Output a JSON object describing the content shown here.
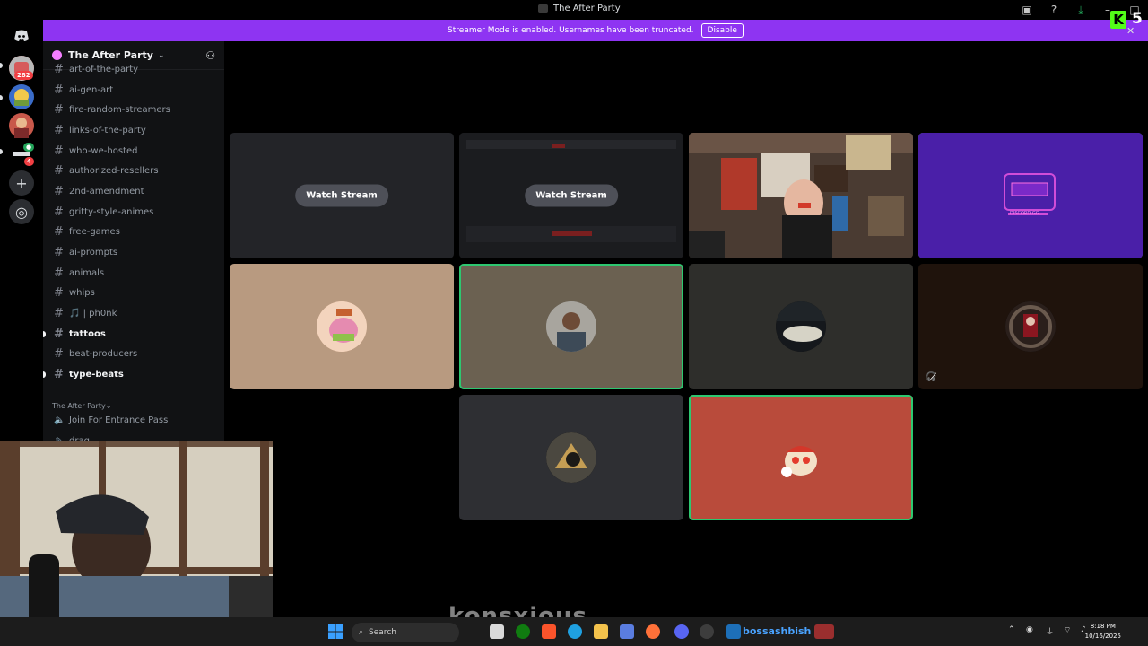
{
  "window": {
    "title": "The After Party"
  },
  "banner": {
    "text": "Streamer Mode is enabled. Usernames have been truncated.",
    "button": "Disable"
  },
  "rail": {
    "badges": [
      "282",
      "4"
    ]
  },
  "sidebar": {
    "server_name": "The After Party",
    "channels": [
      {
        "name": "art-of-the-party",
        "unread": false
      },
      {
        "name": "ai-gen-art",
        "unread": false
      },
      {
        "name": "fire-random-streamers",
        "unread": false
      },
      {
        "name": "links-of-the-party",
        "unread": false
      },
      {
        "name": "who-we-hosted",
        "unread": false
      },
      {
        "name": "authorized-resellers",
        "unread": false
      },
      {
        "name": "2nd-amendment",
        "unread": false
      },
      {
        "name": "gritty-style-animes",
        "unread": false
      },
      {
        "name": "free-games",
        "unread": false
      },
      {
        "name": "ai-prompts",
        "unread": false
      },
      {
        "name": "animals",
        "unread": false
      },
      {
        "name": "whips",
        "unread": false
      },
      {
        "name": "🎵 | ph0nk",
        "unread": false
      },
      {
        "name": "tattoos",
        "unread": true
      },
      {
        "name": "beat-producers",
        "unread": false
      },
      {
        "name": "type-beats",
        "unread": true
      }
    ],
    "category": "The After Party",
    "voice_channels": [
      "Join For Entrance Pass",
      "drag"
    ]
  },
  "stage": {
    "watch_stream": "Watch Stream",
    "stream_overlay_text": "DISCORD.GG"
  },
  "taskbar": {
    "search": "Search",
    "app_label": "bossashbish",
    "time": "8:18 PM",
    "date": "10/16/2025"
  },
  "overlay": {
    "watermark": "konsxious",
    "counter": "5"
  },
  "colors": {
    "banner": "#8e34f2",
    "speaking": "#2dc770",
    "kick_green": "#53fc18"
  }
}
